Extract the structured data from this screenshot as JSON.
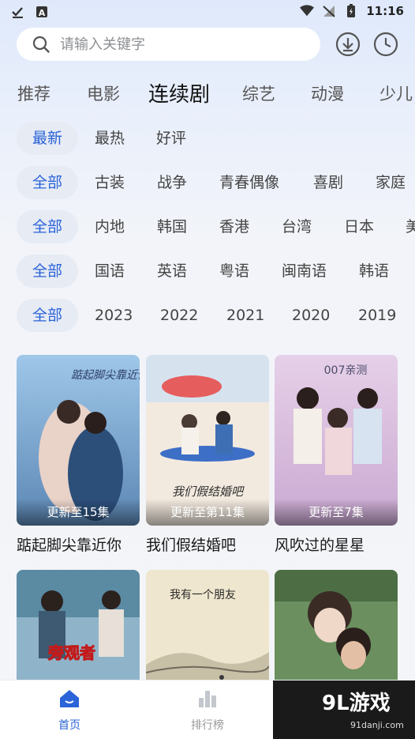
{
  "status_bar": {
    "time": "11:16"
  },
  "search": {
    "placeholder": "请输入关键字"
  },
  "category_tabs": [
    {
      "label": "推荐",
      "active": false
    },
    {
      "label": "电影",
      "active": false
    },
    {
      "label": "连续剧",
      "active": true
    },
    {
      "label": "综艺",
      "active": false
    },
    {
      "label": "动漫",
      "active": false
    },
    {
      "label": "少儿",
      "active": false
    }
  ],
  "filters": {
    "sort": [
      "最新",
      "最热",
      "好评"
    ],
    "genre": [
      "全部",
      "古装",
      "战争",
      "青春偶像",
      "喜剧",
      "家庭"
    ],
    "region": [
      "全部",
      "内地",
      "韩国",
      "香港",
      "台湾",
      "日本",
      "美"
    ],
    "language": [
      "全部",
      "国语",
      "英语",
      "粤语",
      "闽南语",
      "韩语"
    ],
    "year": [
      "全部",
      "2023",
      "2022",
      "2021",
      "2020",
      "2019"
    ]
  },
  "shows": [
    {
      "title": "踮起脚尖靠近你",
      "badge": "更新至15集",
      "poster_text": "踮起脚尖靠近你"
    },
    {
      "title": "我们假结婚吧",
      "badge": "更新至第11集",
      "poster_text": "我们假结婚吧"
    },
    {
      "title": "风吹过的星星",
      "badge": "更新至7集",
      "poster_text": "007亲测"
    },
    {
      "title": "",
      "badge": "",
      "poster_text": "旁观者"
    },
    {
      "title": "",
      "badge": "",
      "poster_text": "我有一个朋友"
    },
    {
      "title": "",
      "badge": "",
      "poster_text": ""
    }
  ],
  "bottom_nav": [
    {
      "label": "首页",
      "active": true
    },
    {
      "label": "排行榜",
      "active": false
    }
  ],
  "watermark": {
    "text": "9L游戏",
    "sub": "91danji.com"
  },
  "colors": {
    "accent": "#2b63d8",
    "chip_bg": "#e6ebf4"
  }
}
